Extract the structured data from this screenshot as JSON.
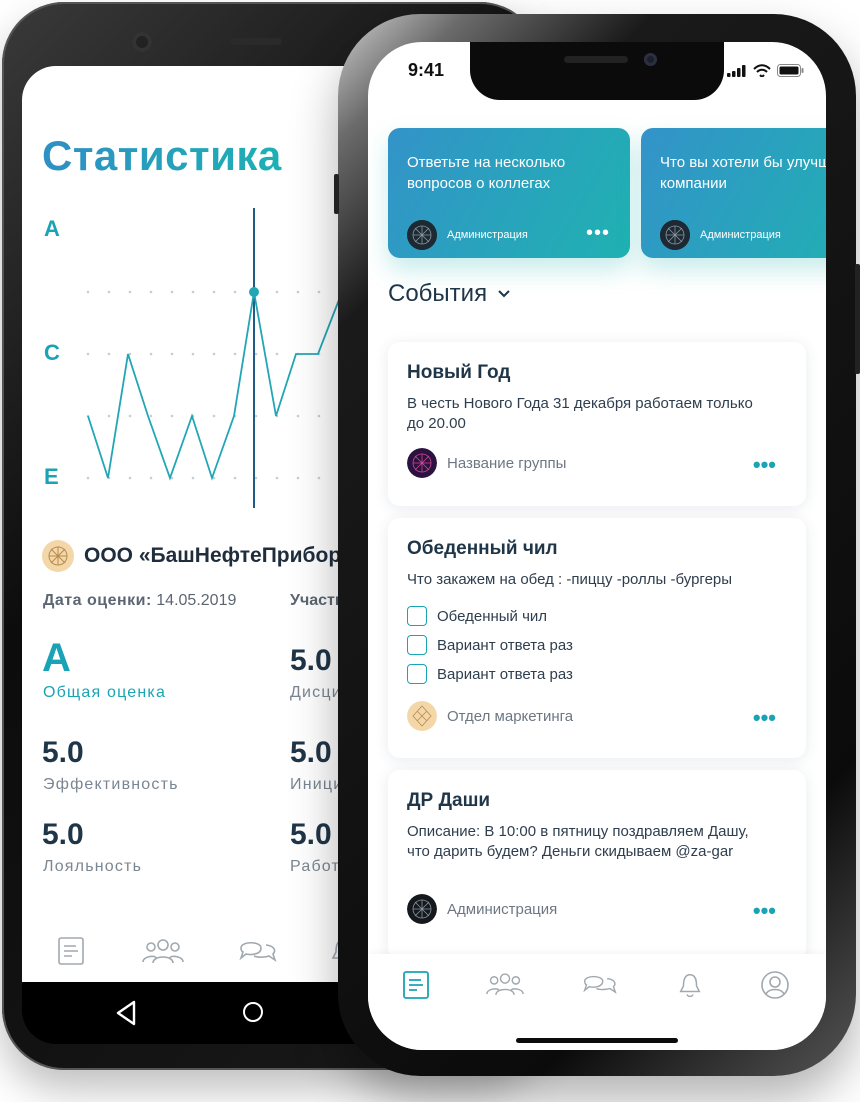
{
  "android": {
    "title": "Статистика",
    "grade_axis": [
      "A",
      "C",
      "E"
    ],
    "company": "ООО «БашНефтеПрибор»",
    "date_label": "Дата оценки:",
    "date_value": "14.05.2019",
    "participants_label": "Участники",
    "overall": {
      "value": "A",
      "label": "Общая оценка"
    },
    "metrics": [
      {
        "value": "5.0",
        "label": "Эффективность"
      },
      {
        "value": "5.0",
        "label": "Лояльность"
      }
    ],
    "metrics_right": [
      {
        "value": "5.0",
        "label": "Дисциплина"
      },
      {
        "value": "5.0",
        "label": "Инициатива"
      },
      {
        "value": "5.0",
        "label": "Работа"
      }
    ],
    "tabs": [
      "feed-icon",
      "team-icon",
      "chat-icon",
      "bell-icon"
    ]
  },
  "iphone": {
    "status_time": "9:41",
    "promos": [
      {
        "text": "Ответьте на несколько вопросов о коллегах",
        "author": "Администрация"
      },
      {
        "text": "Что вы хотели бы улучшить в компании",
        "author": "Администрация"
      }
    ],
    "more_glyph": "•••",
    "events_title": "События",
    "cards": [
      {
        "title": "Новый Год",
        "desc": "В честь Нового Года 31 декабря работаем только до 20.00",
        "group": "Название группы"
      },
      {
        "title": "Обеденный чил",
        "desc": "Что закажем на обед : -пиццу -роллы -бургеры",
        "options": [
          "Обеденный чил",
          "Вариант ответа раз",
          "Вариант ответа раз"
        ],
        "group": "Отдел маркетинга"
      },
      {
        "title": "ДР Даши",
        "desc": "Описание: В 10:00 в пятницу поздравляем Дашу, что дарить будем? Деньги скидываем @za-gar",
        "group": "Администрация"
      }
    ],
    "tabs": [
      "feed-icon",
      "team-icon",
      "chat-icon",
      "bell-icon",
      "profile-icon"
    ]
  },
  "colors": {
    "accent": "#1aa3b5",
    "gradient_start": "#3393c9",
    "gradient_end": "#1fb2b1",
    "text_dark": "#1f3548"
  }
}
